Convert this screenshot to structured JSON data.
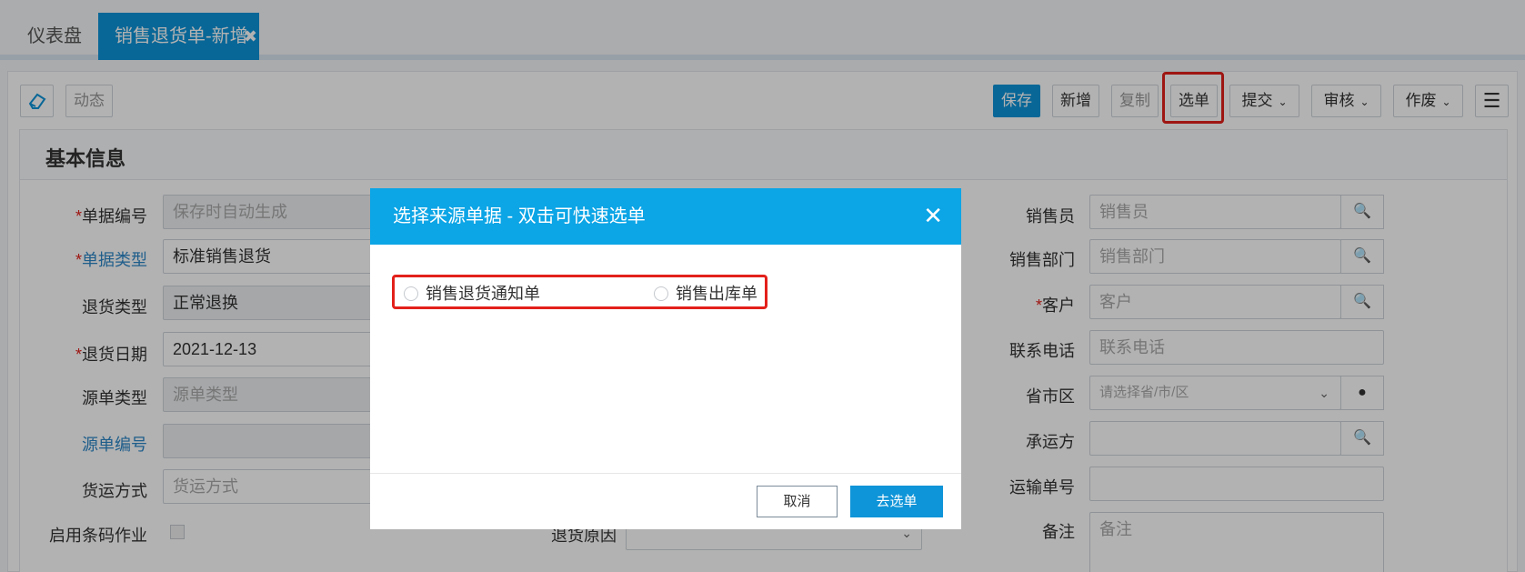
{
  "tabs": [
    {
      "label": "仪表盘"
    },
    {
      "label": "销售退货单-新增",
      "close": "✖"
    }
  ],
  "toolbar": {
    "dynamic": "动态",
    "save": "保存",
    "new": "新增",
    "copy": "复制",
    "select_order": "选单",
    "submit": "提交",
    "review": "审核",
    "void": "作废"
  },
  "section": {
    "title": "基本信息"
  },
  "form_left": {
    "doc_no": {
      "label": "单据编号",
      "placeholder": "保存时自动生成"
    },
    "doc_type": {
      "label": "单据类型",
      "value": "标准销售退货"
    },
    "return_type": {
      "label": "退货类型",
      "value": "正常退换"
    },
    "return_date": {
      "label": "退货日期",
      "value": "2021-12-13"
    },
    "source_type": {
      "label": "源单类型",
      "placeholder": "源单类型"
    },
    "source_no": {
      "label": "源单编号"
    },
    "shipping": {
      "label": "货运方式",
      "placeholder": "货运方式"
    },
    "barcode": {
      "label": "启用条码作业"
    }
  },
  "form_mid": {
    "return_reason": {
      "label": "退货原因"
    }
  },
  "form_right": {
    "salesperson": {
      "label": "销售员",
      "placeholder": "销售员"
    },
    "dept": {
      "label": "销售部门",
      "placeholder": "销售部门"
    },
    "customer": {
      "label": "客户",
      "placeholder": "客户"
    },
    "phone": {
      "label": "联系电话",
      "placeholder": "联系电话"
    },
    "region": {
      "label": "省市区",
      "placeholder": "请选择省/市/区"
    },
    "carrier": {
      "label": "承运方"
    },
    "tracking": {
      "label": "运输单号"
    },
    "remark": {
      "label": "备注",
      "placeholder": "备注"
    }
  },
  "modal": {
    "title": "选择来源单据 - 双击可快速选单",
    "options": [
      "销售退货通知单",
      "销售出库单"
    ],
    "cancel": "取消",
    "confirm": "去选单"
  },
  "colors": {
    "primary": "#0e94d8",
    "modal_header": "#0ca5e6",
    "highlight": "#e3201b"
  }
}
